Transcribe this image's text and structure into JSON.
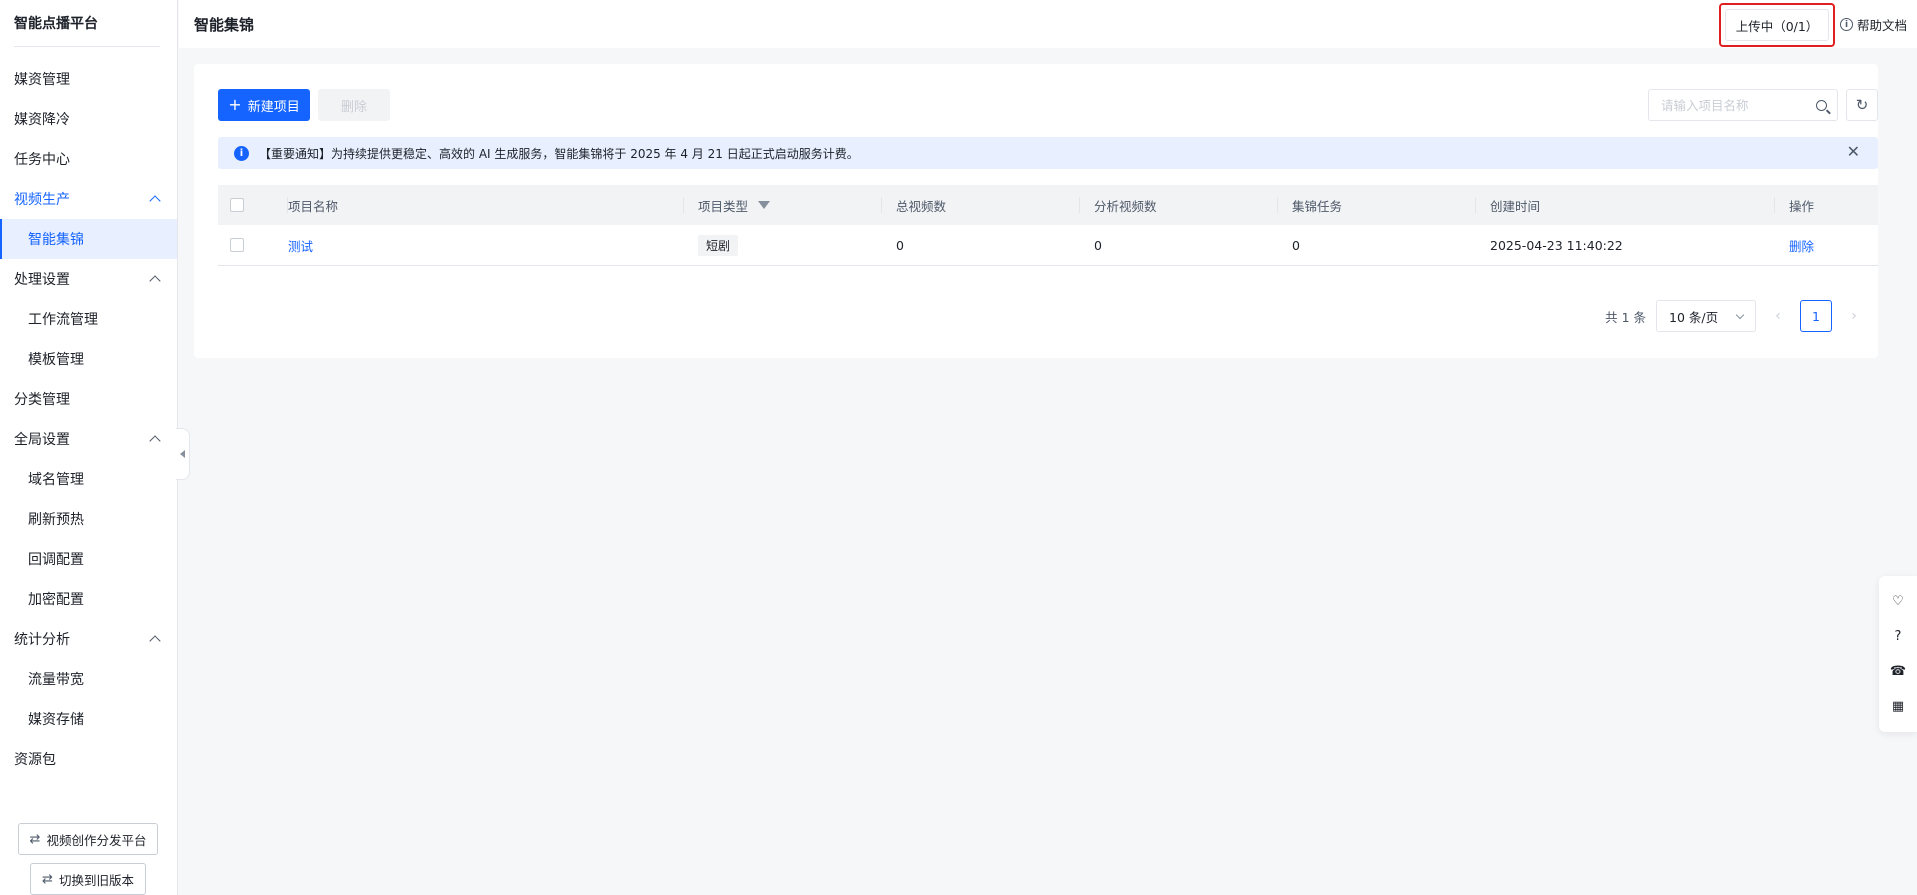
{
  "sidebar": {
    "brand": "智能点播平台",
    "items": [
      {
        "label": "媒资管理"
      },
      {
        "label": "媒资降冷"
      },
      {
        "label": "任务中心"
      }
    ],
    "groups": [
      {
        "label": "视频生产",
        "children": [
          "智能集锦"
        ]
      },
      {
        "label": "处理设置",
        "children": [
          "工作流管理",
          "模板管理"
        ]
      },
      {
        "label": "分类管理"
      },
      {
        "label": "全局设置",
        "children": [
          "域名管理",
          "刷新预热",
          "回调配置",
          "加密配置"
        ]
      },
      {
        "label": "统计分析",
        "children": [
          "流量带宽",
          "媒资存储"
        ]
      },
      {
        "label": "资源包"
      }
    ],
    "bottom_buttons": [
      "视频创作分发平台",
      "切换到旧版本"
    ]
  },
  "header": {
    "title": "智能集锦",
    "upload_status": "上传中（0/1）",
    "help": "帮助文档"
  },
  "toolbar": {
    "new_label": "新建项目",
    "delete_label": "删除",
    "search_placeholder": "请输入项目名称"
  },
  "notice": {
    "text": "【重要通知】为持续提供更稳定、高效的 AI 生成服务，智能集锦将于 2025 年 4 月 21 日起正式启动服务计费。"
  },
  "table": {
    "columns": [
      "项目名称",
      "项目类型",
      "总视频数",
      "分析视频数",
      "集锦任务",
      "创建时间",
      "操作"
    ],
    "rows": [
      {
        "name": "测试",
        "type": "短剧",
        "total": "0",
        "analyzed": "0",
        "tasks": "0",
        "created": "2025-04-23 11:40:22",
        "action": "删除"
      }
    ]
  },
  "pagination": {
    "total_text": "共 1 条",
    "page_size": "10 条/页",
    "current": "1"
  },
  "colors": {
    "primary": "#1664ff",
    "highlight_border": "#e02020"
  }
}
